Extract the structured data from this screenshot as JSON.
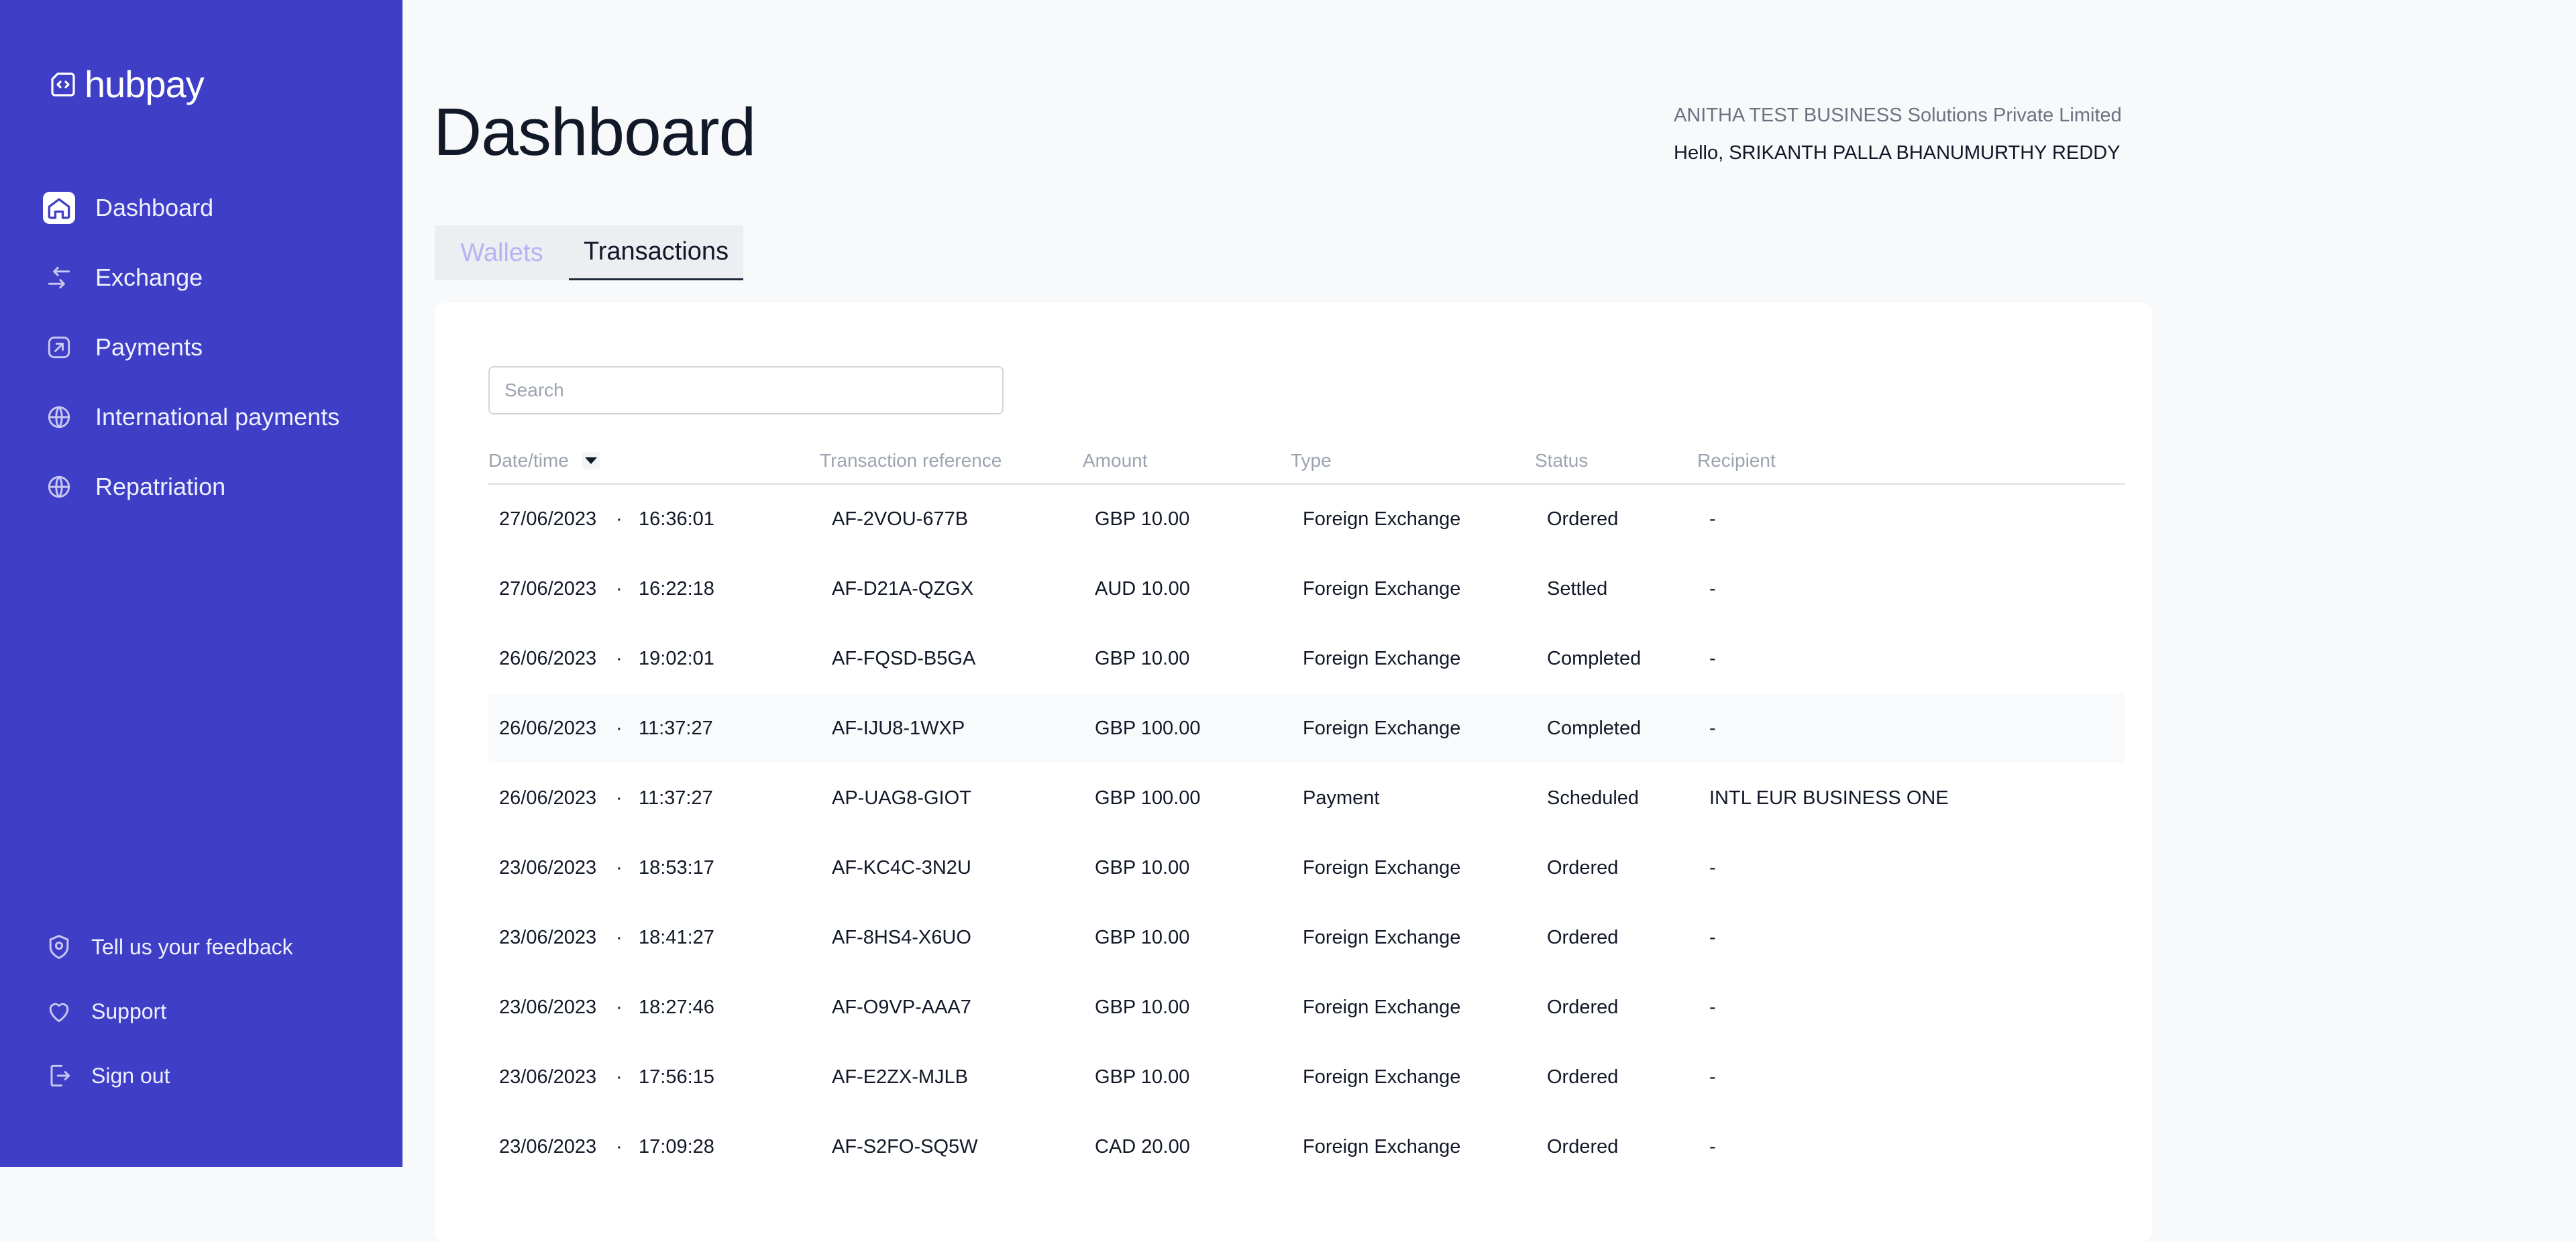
{
  "app": {
    "name": "hubpay"
  },
  "sidebar": {
    "items": [
      {
        "label": "Dashboard",
        "icon": "home-icon",
        "active": true
      },
      {
        "label": "Exchange",
        "icon": "exchange-arrows-icon",
        "active": false
      },
      {
        "label": "Payments",
        "icon": "payment-arrow-icon",
        "active": false
      },
      {
        "label": "International payments",
        "icon": "globe-icon",
        "active": false
      },
      {
        "label": "Repatriation",
        "icon": "globe-icon",
        "active": false
      }
    ],
    "bottom": [
      {
        "label": "Tell us your feedback",
        "icon": "feedback-badge-icon"
      },
      {
        "label": "Support",
        "icon": "heart-icon"
      },
      {
        "label": "Sign out",
        "icon": "sign-out-icon"
      }
    ]
  },
  "header": {
    "title": "Dashboard",
    "company": "ANITHA TEST BUSINESS Solutions Private Limited",
    "greeting": "Hello, SRIKANTH PALLA BHANUMURTHY REDDY"
  },
  "tabs": [
    {
      "label": "Wallets",
      "active": false
    },
    {
      "label": "Transactions",
      "active": true
    }
  ],
  "search": {
    "placeholder": "Search",
    "value": ""
  },
  "table": {
    "columns": [
      "Date/time",
      "Transaction reference",
      "Amount",
      "Type",
      "Status",
      "Recipient"
    ],
    "separator": "·",
    "rows": [
      {
        "date": "27/06/2023",
        "time": "16:36:01",
        "reference": "AF-2VOU-677B",
        "amount": "GBP 10.00",
        "type": "Foreign Exchange",
        "status": "Ordered",
        "recipient": "-"
      },
      {
        "date": "27/06/2023",
        "time": "16:22:18",
        "reference": "AF-D21A-QZGX",
        "amount": "AUD 10.00",
        "type": "Foreign Exchange",
        "status": "Settled",
        "recipient": "-"
      },
      {
        "date": "26/06/2023",
        "time": "19:02:01",
        "reference": "AF-FQSD-B5GA",
        "amount": "GBP 10.00",
        "type": "Foreign Exchange",
        "status": "Completed",
        "recipient": "-"
      },
      {
        "date": "26/06/2023",
        "time": "11:37:27",
        "reference": "AF-IJU8-1WXP",
        "amount": "GBP 100.00",
        "type": "Foreign Exchange",
        "status": "Completed",
        "recipient": "-"
      },
      {
        "date": "26/06/2023",
        "time": "11:37:27",
        "reference": "AP-UAG8-GIOT",
        "amount": "GBP 100.00",
        "type": "Payment",
        "status": "Scheduled",
        "recipient": "INTL EUR BUSINESS ONE"
      },
      {
        "date": "23/06/2023",
        "time": "18:53:17",
        "reference": "AF-KC4C-3N2U",
        "amount": "GBP 10.00",
        "type": "Foreign Exchange",
        "status": "Ordered",
        "recipient": "-"
      },
      {
        "date": "23/06/2023",
        "time": "18:41:27",
        "reference": "AF-8HS4-X6UO",
        "amount": "GBP 10.00",
        "type": "Foreign Exchange",
        "status": "Ordered",
        "recipient": "-"
      },
      {
        "date": "23/06/2023",
        "time": "18:27:46",
        "reference": "AF-O9VP-AAA7",
        "amount": "GBP 10.00",
        "type": "Foreign Exchange",
        "status": "Ordered",
        "recipient": "-"
      },
      {
        "date": "23/06/2023",
        "time": "17:56:15",
        "reference": "AF-E2ZX-MJLB",
        "amount": "GBP 10.00",
        "type": "Foreign Exchange",
        "status": "Ordered",
        "recipient": "-"
      },
      {
        "date": "23/06/2023",
        "time": "17:09:28",
        "reference": "AF-S2FO-SQ5W",
        "amount": "CAD 20.00",
        "type": "Foreign Exchange",
        "status": "Ordered",
        "recipient": "-"
      }
    ]
  },
  "colors": {
    "sidebar_bg": "#3e3ec6",
    "page_bg": "#f8f9fb",
    "inactive_tab": "#b7b3f2",
    "muted_text": "#9ca3af"
  }
}
